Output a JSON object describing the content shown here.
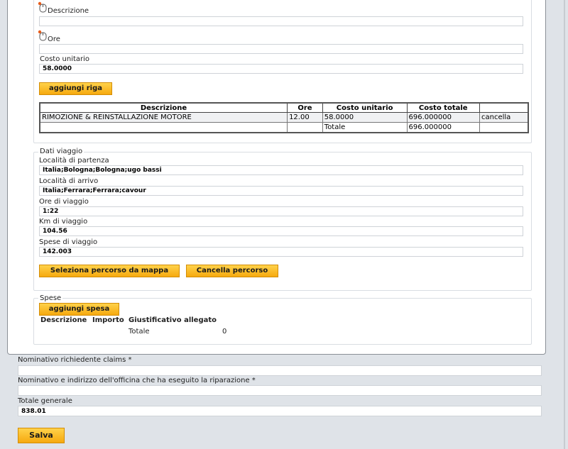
{
  "item_form": {
    "descrizione_label": "Descrizione",
    "ore_label": "Ore",
    "costo_unitario_label": "Costo unitario",
    "costo_unitario_value": "58.0000",
    "aggiungi_riga": "aggiungi riga"
  },
  "items_table": {
    "headers": [
      "Descrizione",
      "Ore",
      "Costo unitario",
      "Costo totale"
    ],
    "row": {
      "descrizione": "RIMOZIONE & REINSTALLAZIONE MOTORE",
      "ore": "12.00",
      "costo_unitario": "58.0000",
      "costo_totale": "696.000000",
      "cancella": "cancella"
    },
    "totale_label": "Totale",
    "totale_value": "696.000000"
  },
  "viaggio": {
    "legend": "Dati viaggio",
    "partenza_label": "Località di partenza",
    "partenza_value": "Italia;Bologna;Bologna;ugo bassi",
    "arrivo_label": "Località di arrivo",
    "arrivo_value": "Italia;Ferrara;Ferrara;cavour",
    "ore_label": "Ore di viaggio",
    "ore_value": "1:22",
    "km_label": "Km di viaggio",
    "km_value": "104.56",
    "spese_label": "Spese di viaggio",
    "spese_value": "142.003",
    "seleziona_btn": "Seleziona percorso da mappa",
    "cancella_btn": "Cancella percorso"
  },
  "spese": {
    "legend": "Spese",
    "aggiungi_btn": "aggiungi spesa",
    "col_descrizione": "Descrizione",
    "col_importo": "Importo",
    "col_giustificativo": "Giustificativo allegato",
    "totale_label": "Totale",
    "totale_value": "0"
  },
  "footer": {
    "richiedente_label": "Nominativo richiedente claims *",
    "officina_label": "Nominativo e indirizzo dell'officina che ha eseguito la riparazione *",
    "totale_generale_label": "Totale generale",
    "totale_generale_value": "838.01",
    "salva": "Salva"
  },
  "colors": {
    "button": "#f6a90f",
    "background": "#dfe3e8"
  },
  "icons": [
    "mouse-icon"
  ]
}
